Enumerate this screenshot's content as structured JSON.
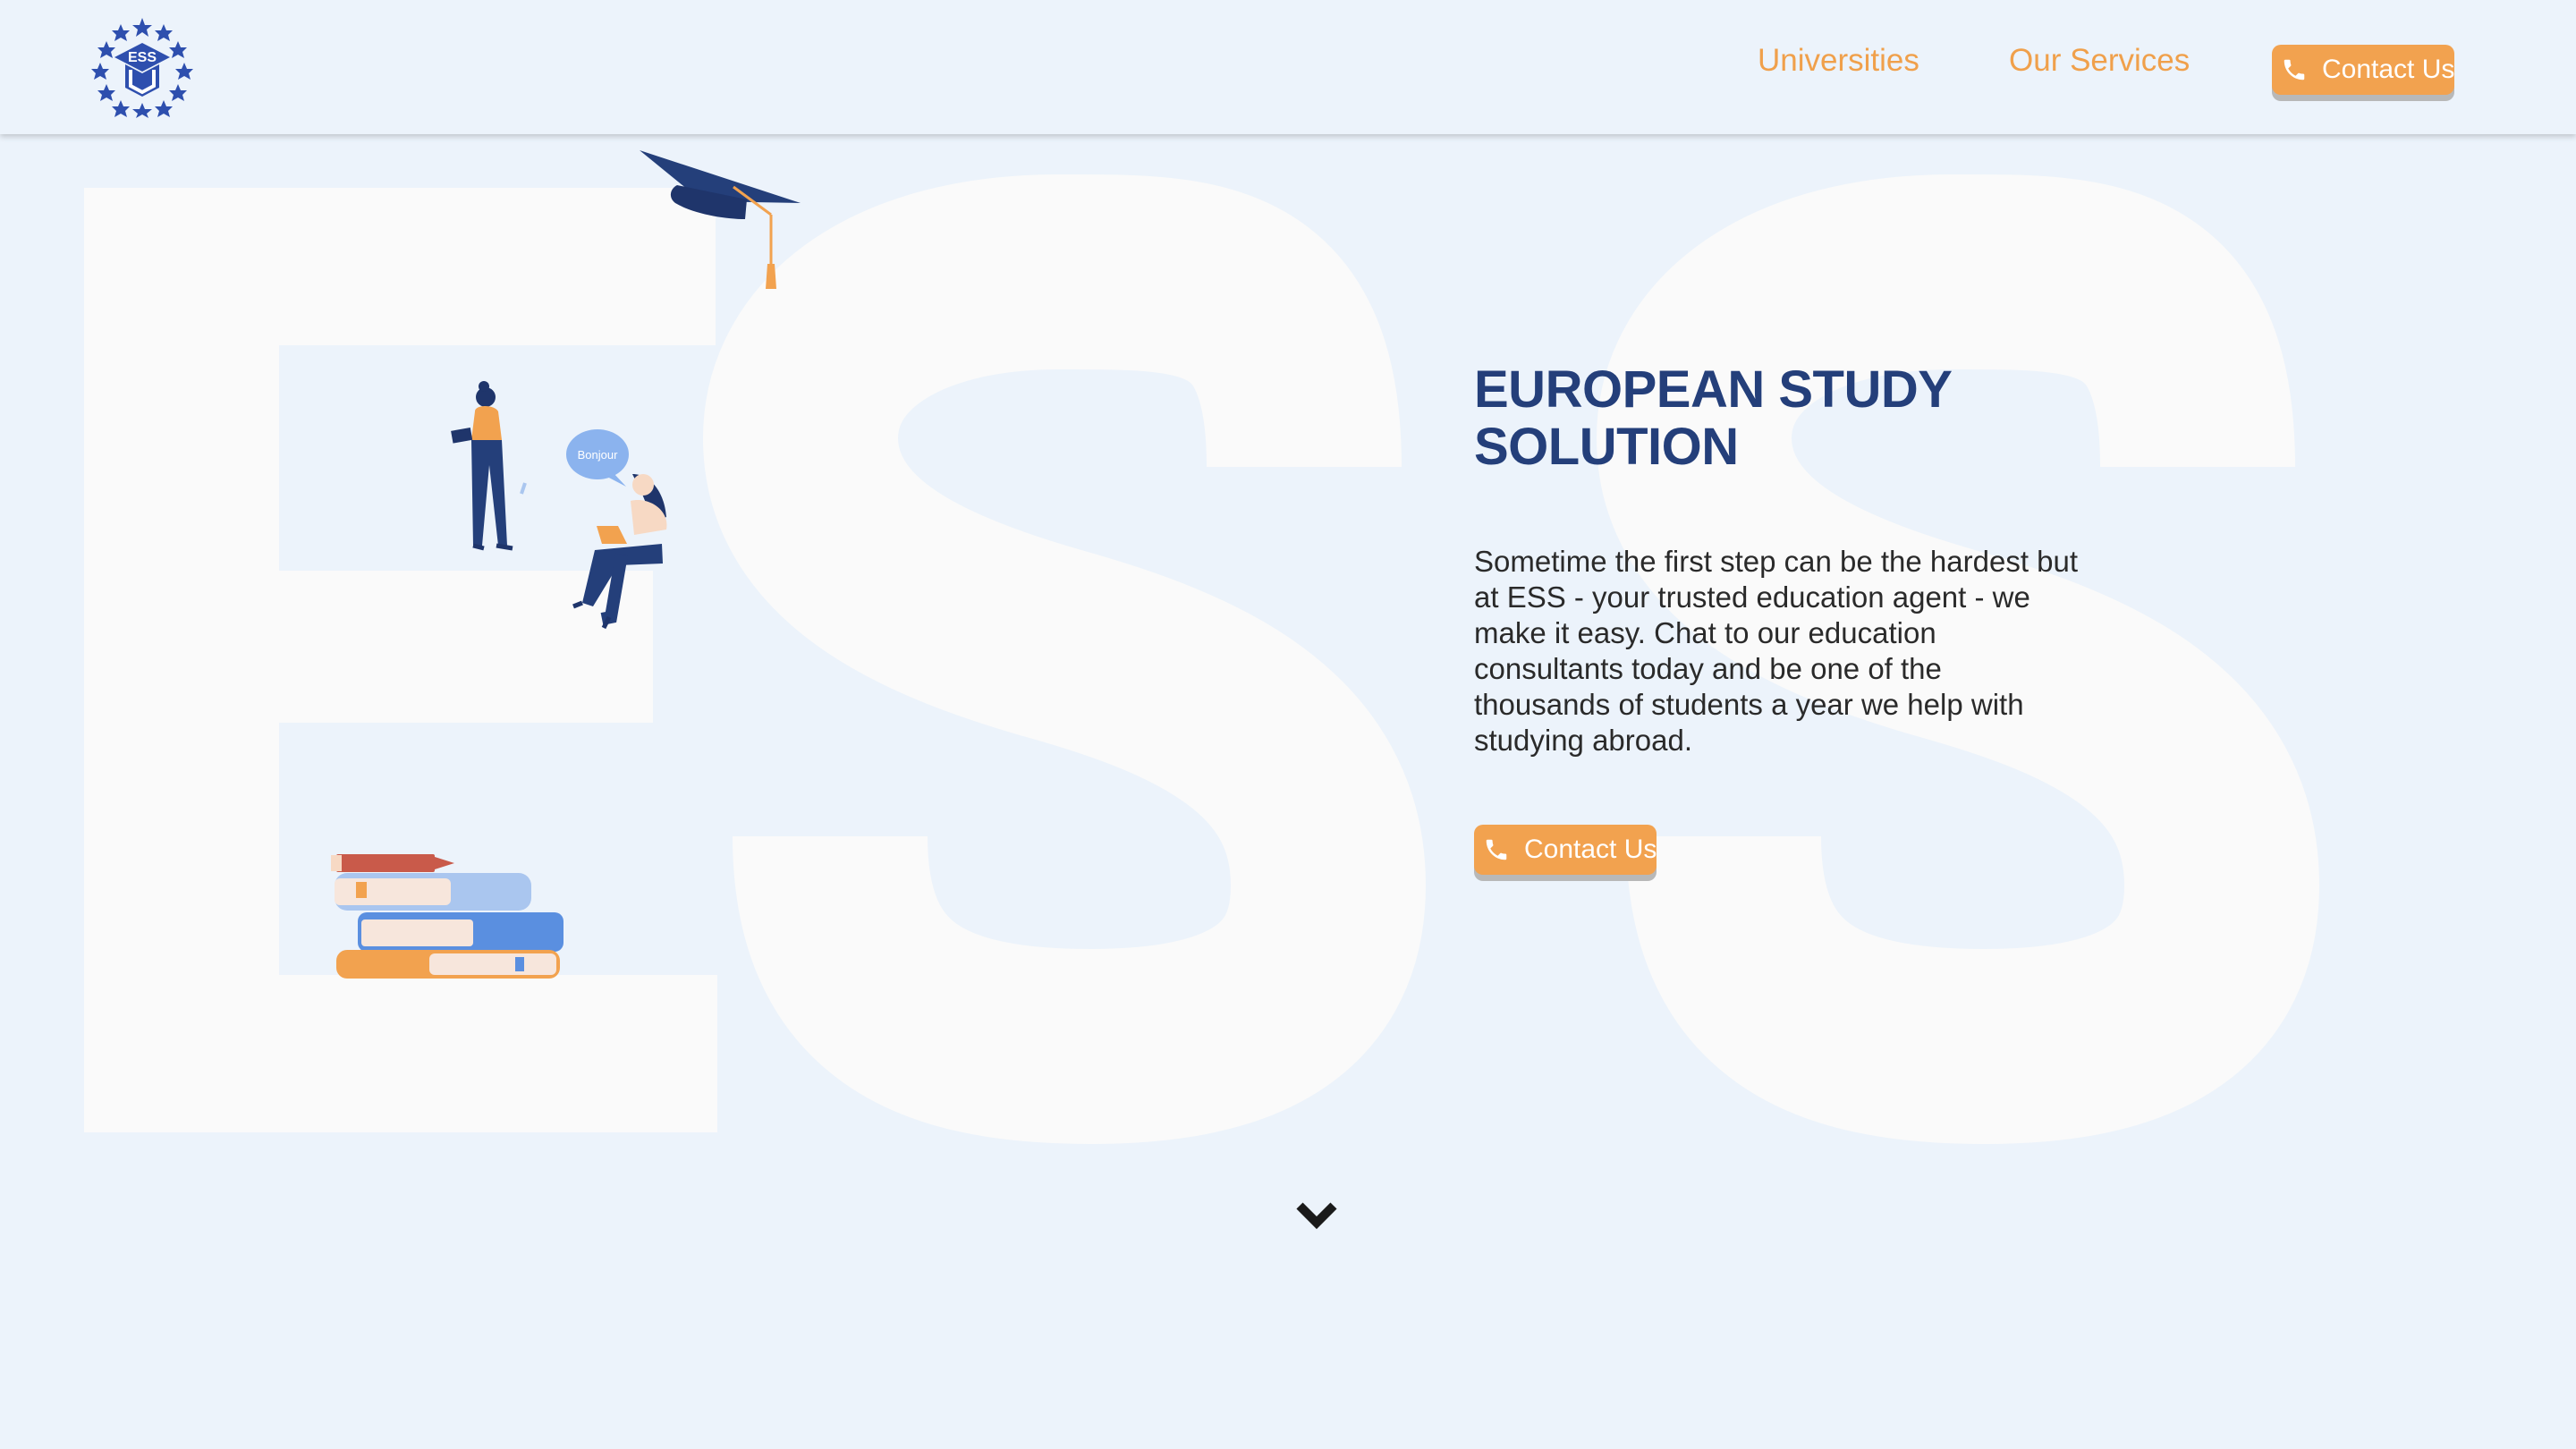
{
  "header": {
    "logo_text": "ESS",
    "nav": [
      {
        "label": "Universities"
      },
      {
        "label": "Our Services"
      }
    ],
    "contact_button": {
      "label": "Contact Us",
      "icon": "phone-icon"
    }
  },
  "hero": {
    "background_letters": "ESS",
    "title": "EUROPEAN STUDY SOLUTION",
    "description": "Sometime the first step can be the hardest but at ESS - your trusted education agent - we make it easy. Chat to our education consultants today and be one of the thousands of students a year we help with studying abroad.",
    "contact_button": {
      "label": "Contact Us",
      "icon": "phone-icon"
    },
    "speech_bubble_text": "Bonjour",
    "scroll_icon": "chevron-down-icon"
  },
  "colors": {
    "background": "#ecf3fb",
    "accent": "#f2a24f",
    "title": "#243f7a",
    "text": "#2a2a2a",
    "letters": "#fafafa"
  }
}
